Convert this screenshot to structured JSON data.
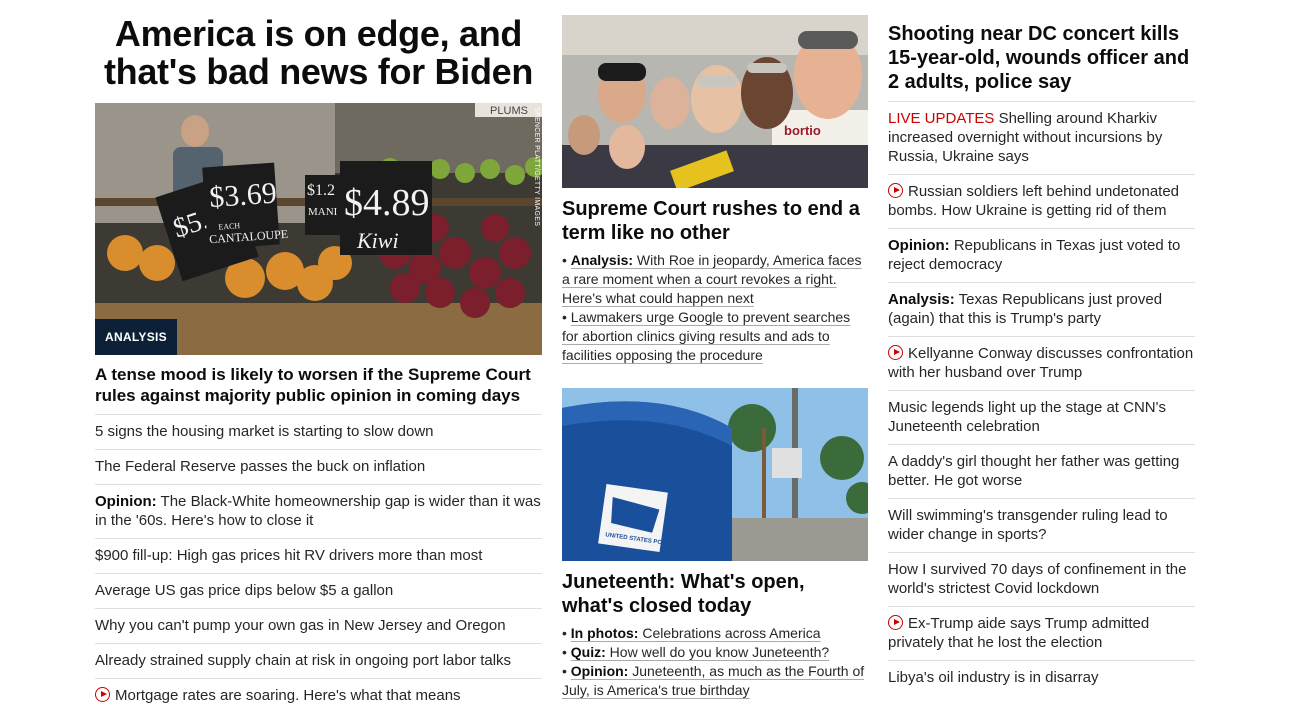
{
  "col1": {
    "headline": "America is on edge, and that's bad news for Biden",
    "hero_badge": "ANALYSIS",
    "hero_credit": "SPENCER PLATT/GETTY IMAGES",
    "hero_caption": "A tense mood is likely to worsen if the Supreme Court rules against majority public opinion in coming days",
    "items": [
      {
        "text": "5 signs the housing market is starting to slow down"
      },
      {
        "text": "The Federal Reserve passes the buck on inflation"
      },
      {
        "prefix": "Opinion:",
        "text": " The Black-White homeownership gap is wider than it was in the '60s. Here's how to close it"
      },
      {
        "text": "$900 fill-up: High gas prices hit RV drivers more than most"
      },
      {
        "text": "Average US gas price dips below $5 a gallon"
      },
      {
        "text": "Why you can't pump your own gas in New Jersey and Oregon"
      },
      {
        "text": "Already strained supply chain at risk in ongoing port labor talks"
      },
      {
        "video": true,
        "text": "Mortgage rates are soaring. Here's what that means"
      }
    ],
    "sign_prices": [
      "$5.99",
      "$3.69",
      "$1.2",
      "$4.89"
    ],
    "sign_words": [
      "EACH",
      "CANTALOUPE",
      "Kiwi",
      "MANI",
      "PLUMS"
    ]
  },
  "col2": {
    "story1": {
      "headline": "Supreme Court rushes to end a term like no other",
      "bullets": [
        {
          "prefix": "Analysis:",
          "text": " With Roe in jeopardy, America faces a rare moment when a court revokes a right. Here's what could happen next"
        },
        {
          "prefix": "",
          "text": "Lawmakers urge Google to prevent searches for abortion clinics giving results and ads to facilities opposing the procedure"
        }
      ]
    },
    "story2": {
      "headline": "Juneteenth: What's open, what's closed today",
      "bullets": [
        {
          "prefix": "In photos:",
          "text": " Celebrations across America"
        },
        {
          "prefix": "Quiz:",
          "text": " How well do you know Juneteenth?"
        },
        {
          "prefix": "Opinion:",
          "text": " Juneteenth, as much as the Fourth of July, is America's true birthday"
        }
      ],
      "mailbox_text": "UNITED STATES POSTAL SERVICE"
    }
  },
  "col3": {
    "headline": "Shooting near DC concert kills 15-year-old, wounds officer and 2 adults, police say",
    "items": [
      {
        "live": "LIVE UPDATES",
        "text": " Shelling around Kharkiv increased overnight without incursions by Russia, Ukraine says"
      },
      {
        "video": true,
        "text": "Russian soldiers left behind undetonated bombs. How Ukraine is getting rid of them"
      },
      {
        "prefix": "Opinion:",
        "text": " Republicans in Texas just voted to reject democracy"
      },
      {
        "prefix": "Analysis:",
        "text": " Texas Republicans just proved (again) that this is Trump's party"
      },
      {
        "video": true,
        "text": "Kellyanne Conway discusses confrontation with her husband over Trump"
      },
      {
        "text": "Music legends light up the stage at CNN's Juneteenth celebration"
      },
      {
        "text": "A daddy's girl thought her father was getting better. He got worse"
      },
      {
        "text": "Will swimming's transgender ruling lead to wider change in sports?"
      },
      {
        "text": "How I survived 70 days of confinement in the world's strictest Covid lockdown"
      },
      {
        "video": true,
        "text": "Ex-Trump aide says Trump admitted privately that he lost the election"
      },
      {
        "text": "Libya's oil industry is in disarray"
      }
    ]
  }
}
